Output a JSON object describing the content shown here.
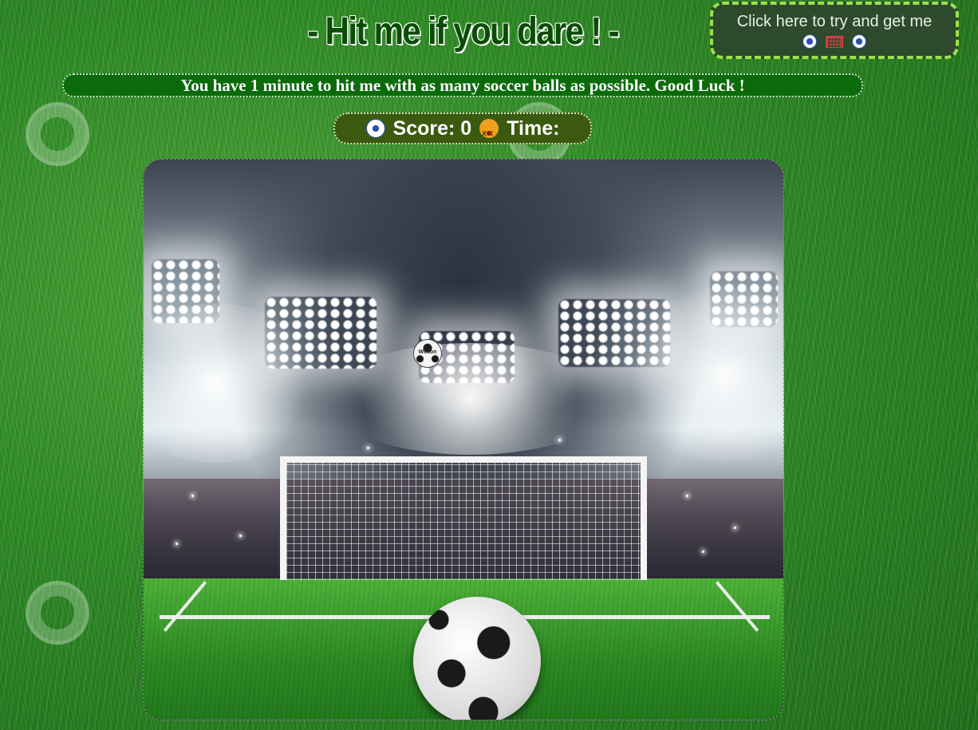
{
  "header": {
    "title": "- Hit me if you dare ! -"
  },
  "try_button": {
    "label": "Click here to try and get me",
    "icons": [
      "soccer-ball-icon",
      "goal-icon",
      "soccer-ball-icon"
    ]
  },
  "instructions": {
    "text": "You have 1 minute to hit me with as many soccer balls as possible. Good Luck !"
  },
  "scorebar": {
    "score_label": "Score: 0",
    "time_label": "Time:"
  },
  "game": {
    "target_brand": "Wilson"
  },
  "colors": {
    "title": "#0a4d06",
    "banner": "#0b6b0b",
    "scorebar": "#3b5a10",
    "try_button_bg": "#2d4a2d",
    "try_button_border": "#9be048"
  }
}
